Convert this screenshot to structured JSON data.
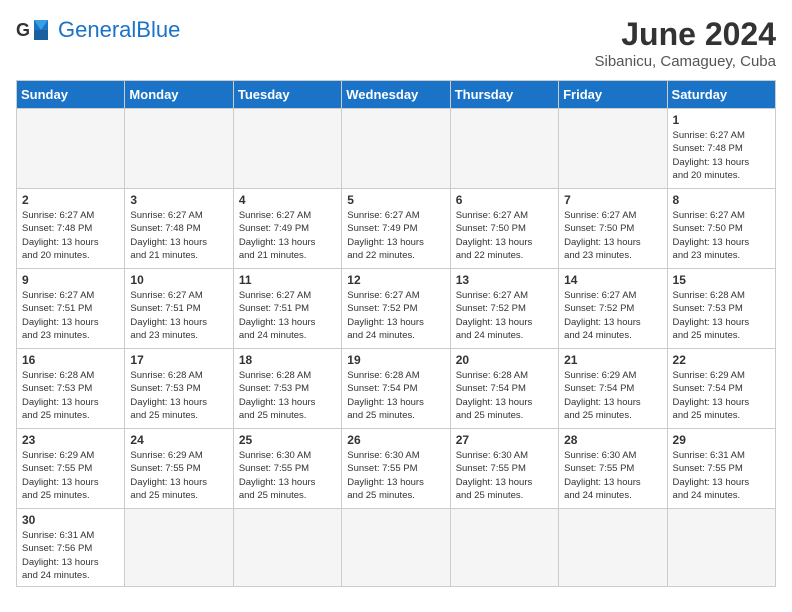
{
  "header": {
    "logo_general": "General",
    "logo_blue": "Blue",
    "month_title": "June 2024",
    "subtitle": "Sibanicu, Camaguey, Cuba"
  },
  "calendar": {
    "weekdays": [
      "Sunday",
      "Monday",
      "Tuesday",
      "Wednesday",
      "Thursday",
      "Friday",
      "Saturday"
    ],
    "weeks": [
      [
        {
          "day": "",
          "info": ""
        },
        {
          "day": "",
          "info": ""
        },
        {
          "day": "",
          "info": ""
        },
        {
          "day": "",
          "info": ""
        },
        {
          "day": "",
          "info": ""
        },
        {
          "day": "",
          "info": ""
        },
        {
          "day": "1",
          "info": "Sunrise: 6:27 AM\nSunset: 7:48 PM\nDaylight: 13 hours\nand 20 minutes."
        }
      ],
      [
        {
          "day": "2",
          "info": "Sunrise: 6:27 AM\nSunset: 7:48 PM\nDaylight: 13 hours\nand 20 minutes."
        },
        {
          "day": "3",
          "info": "Sunrise: 6:27 AM\nSunset: 7:48 PM\nDaylight: 13 hours\nand 21 minutes."
        },
        {
          "day": "4",
          "info": "Sunrise: 6:27 AM\nSunset: 7:49 PM\nDaylight: 13 hours\nand 21 minutes."
        },
        {
          "day": "5",
          "info": "Sunrise: 6:27 AM\nSunset: 7:49 PM\nDaylight: 13 hours\nand 22 minutes."
        },
        {
          "day": "6",
          "info": "Sunrise: 6:27 AM\nSunset: 7:50 PM\nDaylight: 13 hours\nand 22 minutes."
        },
        {
          "day": "7",
          "info": "Sunrise: 6:27 AM\nSunset: 7:50 PM\nDaylight: 13 hours\nand 23 minutes."
        },
        {
          "day": "8",
          "info": "Sunrise: 6:27 AM\nSunset: 7:50 PM\nDaylight: 13 hours\nand 23 minutes."
        }
      ],
      [
        {
          "day": "9",
          "info": "Sunrise: 6:27 AM\nSunset: 7:51 PM\nDaylight: 13 hours\nand 23 minutes."
        },
        {
          "day": "10",
          "info": "Sunrise: 6:27 AM\nSunset: 7:51 PM\nDaylight: 13 hours\nand 23 minutes."
        },
        {
          "day": "11",
          "info": "Sunrise: 6:27 AM\nSunset: 7:51 PM\nDaylight: 13 hours\nand 24 minutes."
        },
        {
          "day": "12",
          "info": "Sunrise: 6:27 AM\nSunset: 7:52 PM\nDaylight: 13 hours\nand 24 minutes."
        },
        {
          "day": "13",
          "info": "Sunrise: 6:27 AM\nSunset: 7:52 PM\nDaylight: 13 hours\nand 24 minutes."
        },
        {
          "day": "14",
          "info": "Sunrise: 6:27 AM\nSunset: 7:52 PM\nDaylight: 13 hours\nand 24 minutes."
        },
        {
          "day": "15",
          "info": "Sunrise: 6:28 AM\nSunset: 7:53 PM\nDaylight: 13 hours\nand 25 minutes."
        }
      ],
      [
        {
          "day": "16",
          "info": "Sunrise: 6:28 AM\nSunset: 7:53 PM\nDaylight: 13 hours\nand 25 minutes."
        },
        {
          "day": "17",
          "info": "Sunrise: 6:28 AM\nSunset: 7:53 PM\nDaylight: 13 hours\nand 25 minutes."
        },
        {
          "day": "18",
          "info": "Sunrise: 6:28 AM\nSunset: 7:53 PM\nDaylight: 13 hours\nand 25 minutes."
        },
        {
          "day": "19",
          "info": "Sunrise: 6:28 AM\nSunset: 7:54 PM\nDaylight: 13 hours\nand 25 minutes."
        },
        {
          "day": "20",
          "info": "Sunrise: 6:28 AM\nSunset: 7:54 PM\nDaylight: 13 hours\nand 25 minutes."
        },
        {
          "day": "21",
          "info": "Sunrise: 6:29 AM\nSunset: 7:54 PM\nDaylight: 13 hours\nand 25 minutes."
        },
        {
          "day": "22",
          "info": "Sunrise: 6:29 AM\nSunset: 7:54 PM\nDaylight: 13 hours\nand 25 minutes."
        }
      ],
      [
        {
          "day": "23",
          "info": "Sunrise: 6:29 AM\nSunset: 7:55 PM\nDaylight: 13 hours\nand 25 minutes."
        },
        {
          "day": "24",
          "info": "Sunrise: 6:29 AM\nSunset: 7:55 PM\nDaylight: 13 hours\nand 25 minutes."
        },
        {
          "day": "25",
          "info": "Sunrise: 6:30 AM\nSunset: 7:55 PM\nDaylight: 13 hours\nand 25 minutes."
        },
        {
          "day": "26",
          "info": "Sunrise: 6:30 AM\nSunset: 7:55 PM\nDaylight: 13 hours\nand 25 minutes."
        },
        {
          "day": "27",
          "info": "Sunrise: 6:30 AM\nSunset: 7:55 PM\nDaylight: 13 hours\nand 25 minutes."
        },
        {
          "day": "28",
          "info": "Sunrise: 6:30 AM\nSunset: 7:55 PM\nDaylight: 13 hours\nand 24 minutes."
        },
        {
          "day": "29",
          "info": "Sunrise: 6:31 AM\nSunset: 7:55 PM\nDaylight: 13 hours\nand 24 minutes."
        }
      ],
      [
        {
          "day": "30",
          "info": "Sunrise: 6:31 AM\nSunset: 7:56 PM\nDaylight: 13 hours\nand 24 minutes."
        },
        {
          "day": "",
          "info": ""
        },
        {
          "day": "",
          "info": ""
        },
        {
          "day": "",
          "info": ""
        },
        {
          "day": "",
          "info": ""
        },
        {
          "day": "",
          "info": ""
        },
        {
          "day": "",
          "info": ""
        }
      ]
    ]
  }
}
